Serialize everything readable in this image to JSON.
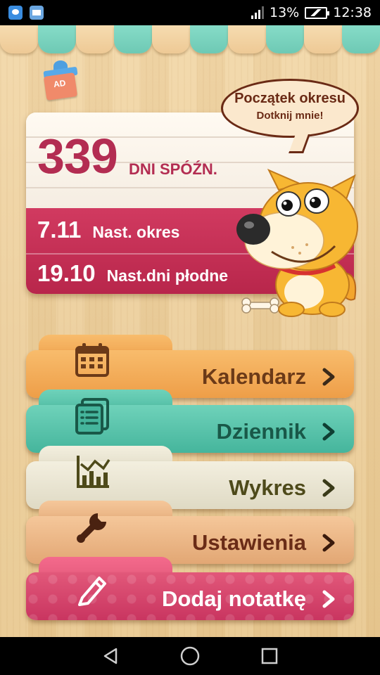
{
  "status_bar": {
    "battery_percent": "13%",
    "time": "12:38",
    "notification_icons": [
      "messenger-icon",
      "mail-icon"
    ]
  },
  "colors": {
    "card_accent": "#b32d52",
    "kalendarz": "#ee9e48",
    "dziennik": "#45b59c",
    "wykres": "#dfdac4",
    "ustawienia": "#e2a774",
    "dodaj": "#c93560"
  },
  "gift": {
    "label": "AD"
  },
  "speech_bubble": {
    "title": "Początek okresu",
    "subtitle": "Dotknij mnie!"
  },
  "summary": {
    "days_count": "339",
    "days_label": "DNI SPÓŹN.",
    "next_period_date": "7.11",
    "next_period_label": "Nast. okres",
    "next_fertile_date": "19.10",
    "next_fertile_label": "Nast.dni płodne"
  },
  "menu": {
    "kalendarz": {
      "label": "Kalendarz",
      "icon": "calendar-icon"
    },
    "dziennik": {
      "label": "Dziennik",
      "icon": "journal-icon"
    },
    "wykres": {
      "label": "Wykres",
      "icon": "chart-icon"
    },
    "ustawienia": {
      "label": "Ustawienia",
      "icon": "wrench-icon"
    },
    "dodaj": {
      "label": "Dodaj notatkę",
      "icon": "pencil-icon"
    }
  },
  "nav": {
    "back": "back-icon",
    "home": "home-icon",
    "recents": "recents-icon"
  }
}
